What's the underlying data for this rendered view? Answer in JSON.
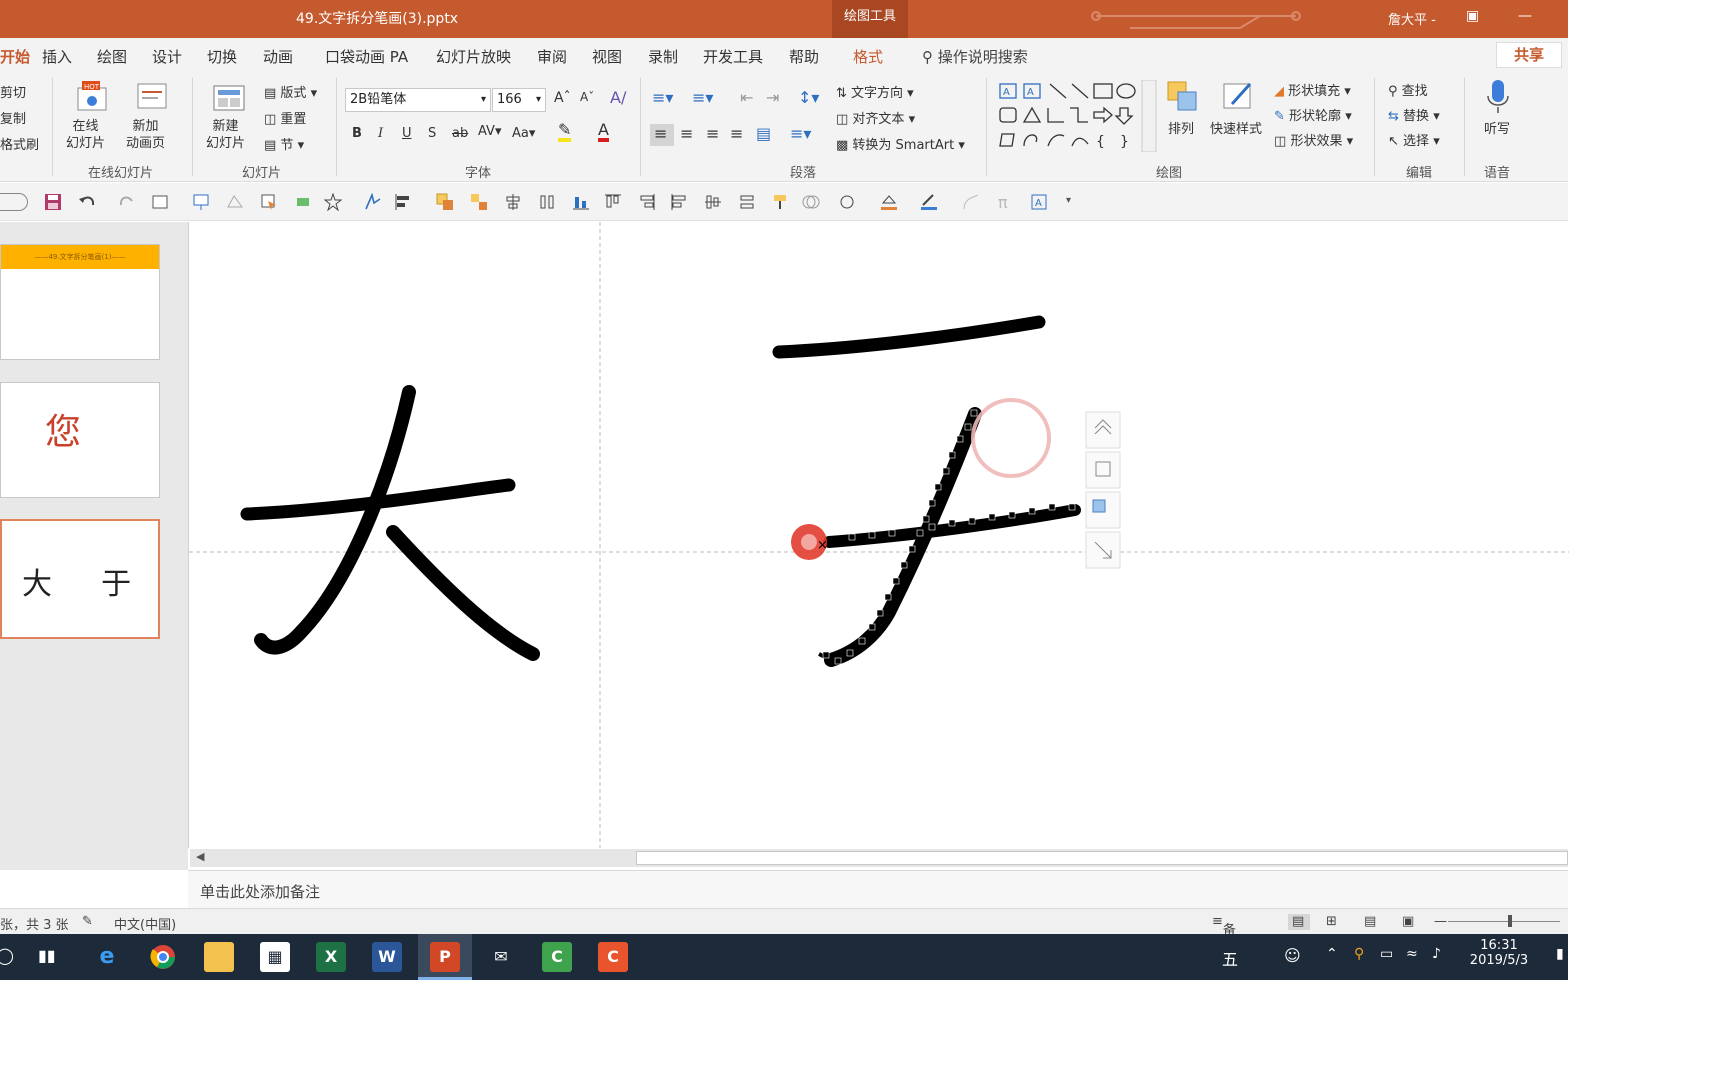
{
  "window": {
    "doc_title": "49.文字拆分笔画(3).pptx",
    "context_tab_group": "绘图工具",
    "user": "詹大平 -"
  },
  "tabs": [
    {
      "label": "开始"
    },
    {
      "label": "插入"
    },
    {
      "label": "绘图"
    },
    {
      "label": "设计"
    },
    {
      "label": "切换"
    },
    {
      "label": "动画"
    },
    {
      "label": "口袋动画 PA"
    },
    {
      "label": "幻灯片放映"
    },
    {
      "label": "审阅"
    },
    {
      "label": "视图"
    },
    {
      "label": "录制"
    },
    {
      "label": "开发工具"
    },
    {
      "label": "帮助"
    },
    {
      "label": "格式"
    }
  ],
  "tell_me": "操作说明搜索",
  "share": "共享",
  "ribbon": {
    "clipboard": {
      "cut": "剪切",
      "copy": "复制",
      "painter": "格式刷"
    },
    "online": {
      "online_slides": "在线\n幻灯片",
      "new_anim": "新加\n动画页",
      "group": "在线幻灯片"
    },
    "slides": {
      "new_slide": "新建\n幻灯片",
      "layout": "版式",
      "reset": "重置",
      "section": "节",
      "group": "幻灯片"
    },
    "font": {
      "name": "2B铅笔体",
      "size": "166",
      "group": "字体"
    },
    "paragraph": {
      "text_direction": "文字方向",
      "align_text": "对齐文本",
      "smartart": "转换为 SmartArt",
      "group": "段落"
    },
    "drawing": {
      "arrange": "排列",
      "quick_styles": "快速样式",
      "fill": "形状填充",
      "outline": "形状轮廓",
      "effects": "形状效果",
      "group": "绘图"
    },
    "editing": {
      "find": "查找",
      "replace": "替换",
      "select": "选择",
      "group": "编辑"
    },
    "voice": {
      "dictate": "听写",
      "group": "语音"
    }
  },
  "slides": [
    {
      "banner": "——49.文字拆分笔画(1)——"
    },
    {
      "char": "您"
    },
    {
      "chars": "大 　 于"
    }
  ],
  "notes_placeholder": "单击此处添加备注",
  "status": {
    "slide_info": "张，共 3 张",
    "language": "中文(中国)",
    "notes_btn": "备注"
  },
  "taskbar": {
    "ime": "五",
    "time": "16:31",
    "date": "2019/5/3"
  },
  "colors": {
    "accent": "#c55a2f",
    "ribbon_bg": "#f3f3f3",
    "taskbar": "#1d2a3a"
  }
}
